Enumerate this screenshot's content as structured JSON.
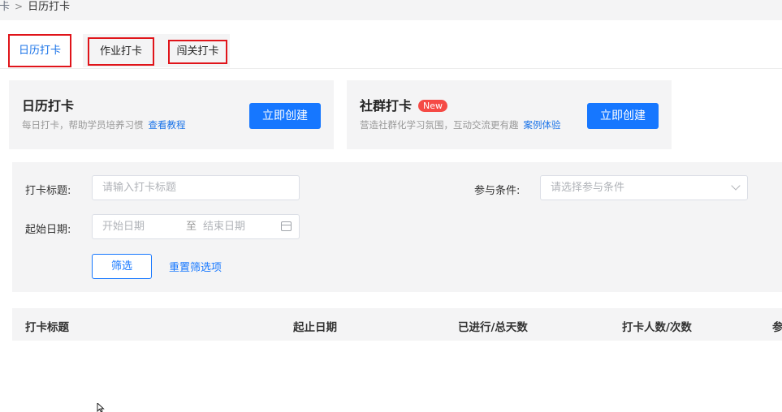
{
  "breadcrumb": {
    "prev": "打卡",
    "separator": ">",
    "current": "日历打卡"
  },
  "tabs": [
    {
      "label": "日历打卡",
      "active": true
    },
    {
      "label": "作业打卡",
      "active": false
    },
    {
      "label": "闯关打卡",
      "active": false
    }
  ],
  "cards": [
    {
      "title": "日历打卡",
      "badge": "",
      "desc": "每日打卡，帮助学员培养习惯",
      "link": "查看教程",
      "button": "立即创建"
    },
    {
      "title": "社群打卡",
      "badge": "New",
      "desc": "营造社群化学习氛围，互动交流更有趣",
      "link": "案例体验",
      "button": "立即创建"
    }
  ],
  "filter": {
    "title_label": "打卡标题:",
    "title_placeholder": "请输入打卡标题",
    "condition_label": "参与条件:",
    "condition_placeholder": "请选择参与条件",
    "date_label": "起始日期:",
    "date_start_placeholder": "开始日期",
    "date_sep": "至",
    "date_end_placeholder": "结束日期",
    "filter_button": "筛选",
    "reset_link": "重置筛选项"
  },
  "table": {
    "columns": [
      "打卡标题",
      "起止日期",
      "已进行/总天数",
      "打卡人数/次数",
      "参"
    ]
  },
  "colors": {
    "primary": "#1677ff",
    "highlight_box": "#e0141a",
    "badge": "#f54a45",
    "panel_bg": "#f4f4f5"
  }
}
